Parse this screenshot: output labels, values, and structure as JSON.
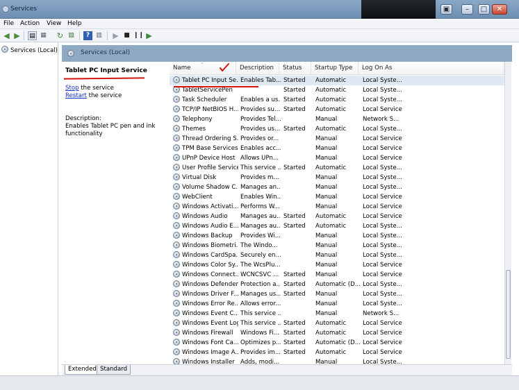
{
  "window": {
    "title": "Services"
  },
  "menu": [
    "File",
    "Action",
    "View",
    "Help"
  ],
  "toolbar": {
    "icons": [
      "back-icon",
      "forward-icon",
      "console-tree-icon",
      "properties-icon",
      "refresh-icon",
      "export-icon",
      "help-icon",
      "show-hide-icon",
      "start-icon",
      "stop-icon",
      "pause-icon",
      "restart-icon"
    ]
  },
  "tree": {
    "item": "Services (Local)"
  },
  "pane_header": {
    "title": "Services (Local)"
  },
  "details": {
    "service_name": "Tablet PC Input Service",
    "stop_link": "Stop",
    "stop_rest": " the service",
    "restart_link": "Restart",
    "restart_rest": " the service",
    "description_label": "Description:",
    "description": "Enables Tablet PC pen and ink functionality"
  },
  "columns": {
    "name": "Name",
    "description": "Description",
    "status": "Status",
    "startup_type": "Startup Type",
    "log_on_as": "Log On As"
  },
  "services": [
    {
      "name": "Tablet PC Input Se...",
      "description": "Enables Tab...",
      "status": "Started",
      "startup": "Automatic",
      "logon": "Local Syste...",
      "selected": true
    },
    {
      "name": "TabletServicePen",
      "description": "",
      "status": "Started",
      "startup": "Automatic",
      "logon": "Local Syste..."
    },
    {
      "name": "Task Scheduler",
      "description": "Enables a us...",
      "status": "Started",
      "startup": "Automatic",
      "logon": "Local Syste..."
    },
    {
      "name": "TCP/IP NetBIOS H...",
      "description": "Provides su...",
      "status": "Started",
      "startup": "Automatic",
      "logon": "Local Service"
    },
    {
      "name": "Telephony",
      "description": "Provides Tel...",
      "status": "",
      "startup": "Manual",
      "logon": "Network S..."
    },
    {
      "name": "Themes",
      "description": "Provides us...",
      "status": "Started",
      "startup": "Automatic",
      "logon": "Local Syste..."
    },
    {
      "name": "Thread Ordering S...",
      "description": "Provides or...",
      "status": "",
      "startup": "Manual",
      "logon": "Local Service"
    },
    {
      "name": "TPM Base Services",
      "description": "Enables acc...",
      "status": "",
      "startup": "Manual",
      "logon": "Local Service"
    },
    {
      "name": "UPnP Device Host",
      "description": "Allows UPn...",
      "status": "",
      "startup": "Manual",
      "logon": "Local Service"
    },
    {
      "name": "User Profile Service",
      "description": "This service ...",
      "status": "Started",
      "startup": "Automatic",
      "logon": "Local Syste..."
    },
    {
      "name": "Virtual Disk",
      "description": "Provides m...",
      "status": "",
      "startup": "Manual",
      "logon": "Local Syste..."
    },
    {
      "name": "Volume Shadow C...",
      "description": "Manages an...",
      "status": "",
      "startup": "Manual",
      "logon": "Local Syste..."
    },
    {
      "name": "WebClient",
      "description": "Enables Win...",
      "status": "",
      "startup": "Manual",
      "logon": "Local Service"
    },
    {
      "name": "Windows Activati...",
      "description": "Performs W...",
      "status": "",
      "startup": "Manual",
      "logon": "Local Service"
    },
    {
      "name": "Windows Audio",
      "description": "Manages au...",
      "status": "Started",
      "startup": "Automatic",
      "logon": "Local Service"
    },
    {
      "name": "Windows Audio E...",
      "description": "Manages au...",
      "status": "Started",
      "startup": "Automatic",
      "logon": "Local Syste..."
    },
    {
      "name": "Windows Backup",
      "description": "Provides Wi...",
      "status": "",
      "startup": "Manual",
      "logon": "Local Syste..."
    },
    {
      "name": "Windows Biometri...",
      "description": "The Windo...",
      "status": "",
      "startup": "Manual",
      "logon": "Local Syste..."
    },
    {
      "name": "Windows CardSpa...",
      "description": "Securely en...",
      "status": "",
      "startup": "Manual",
      "logon": "Local Syste..."
    },
    {
      "name": "Windows Color Sy...",
      "description": "The WcsPlu...",
      "status": "",
      "startup": "Manual",
      "logon": "Local Service"
    },
    {
      "name": "Windows Connect...",
      "description": "WCNCSVC ...",
      "status": "Started",
      "startup": "Manual",
      "logon": "Local Service"
    },
    {
      "name": "Windows Defender",
      "description": "Protection a...",
      "status": "Started",
      "startup": "Automatic (D...",
      "logon": "Local Syste..."
    },
    {
      "name": "Windows Driver F...",
      "description": "Manages us...",
      "status": "Started",
      "startup": "Manual",
      "logon": "Local Syste..."
    },
    {
      "name": "Windows Error Re...",
      "description": "Allows error...",
      "status": "",
      "startup": "Manual",
      "logon": "Local Syste..."
    },
    {
      "name": "Windows Event C...",
      "description": "This service ...",
      "status": "",
      "startup": "Manual",
      "logon": "Network S..."
    },
    {
      "name": "Windows Event Log",
      "description": "This service ...",
      "status": "Started",
      "startup": "Automatic",
      "logon": "Local Service"
    },
    {
      "name": "Windows Firewall",
      "description": "Windows Fi...",
      "status": "Started",
      "startup": "Automatic",
      "logon": "Local Service"
    },
    {
      "name": "Windows Font Ca...",
      "description": "Optimizes p...",
      "status": "Started",
      "startup": "Automatic (D...",
      "logon": "Local Service"
    },
    {
      "name": "Windows Image A...",
      "description": "Provides im...",
      "status": "Started",
      "startup": "Automatic",
      "logon": "Local Service"
    },
    {
      "name": "Windows Installer",
      "description": "Adds, modi...",
      "status": "",
      "startup": "Manual",
      "logon": "Local Syste..."
    }
  ],
  "tabs": [
    "Extended",
    "Standard"
  ],
  "colors": {
    "annotation_red": "#d3140b",
    "header_band": "#8ea9c3",
    "link_blue": "#1030c8"
  }
}
